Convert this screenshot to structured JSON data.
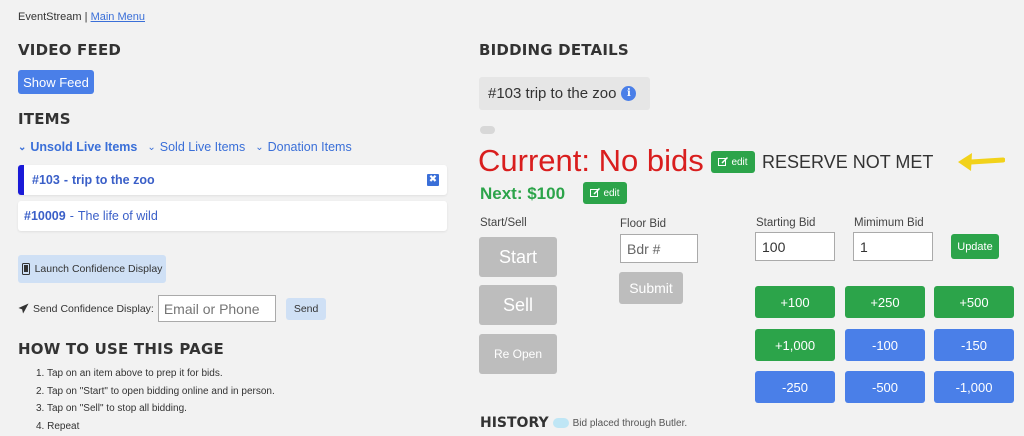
{
  "topbar": {
    "app_name": "EventStream",
    "separator": "|",
    "main_menu": "Main Menu"
  },
  "video_feed": {
    "heading": "VIDEO FEED",
    "show_feed": "Show Feed"
  },
  "items": {
    "heading": "ITEMS",
    "tabs": [
      {
        "label": "Unsold Live Items",
        "active": true
      },
      {
        "label": "Sold Live Items",
        "active": false
      },
      {
        "label": "Donation Items",
        "active": false
      }
    ],
    "list": [
      {
        "number": "#103",
        "name": "trip to the zoo",
        "selected": true
      },
      {
        "number": "#10009",
        "name": "The life of wild",
        "selected": false
      }
    ],
    "close_glyph": "✖"
  },
  "confidence": {
    "launch_label": "Launch Confidence Display",
    "send_label": "Send Confidence Display:",
    "input_placeholder": "Email or Phone",
    "send_button": "Send"
  },
  "howto": {
    "heading": "HOW TO USE THIS PAGE",
    "steps": [
      "Tap on an item above to prep it for bids.",
      "Tap on \"Start\" to open bidding online and in person.",
      "Tap on \"Sell\" to stop all bidding.",
      "Repeat"
    ]
  },
  "bidding": {
    "heading": "BIDDING DETAILS",
    "item_title": "#103 trip to the zoo",
    "info_glyph": "i",
    "current": "Current: No bids",
    "edit_label": "edit",
    "reserve": "RESERVE NOT MET",
    "next": "Next: $100",
    "start_sell_label": "Start/Sell",
    "start": "Start",
    "sell": "Sell",
    "reopen": "Re Open",
    "floor_bid_label": "Floor Bid",
    "bidder_placeholder": "Bdr #",
    "submit": "Submit",
    "starting_bid_label": "Starting Bid",
    "starting_bid_value": "100",
    "minimum_bid_label": "Mimimum Bid",
    "minimum_bid_value": "1",
    "update": "Update",
    "increments": [
      "+100",
      "+250",
      "+500",
      "+1,000",
      "-100",
      "-150",
      "-250",
      "-500",
      "-1,000"
    ]
  },
  "history": {
    "heading": "HISTORY",
    "legend": "Bid placed through Butler."
  },
  "colors": {
    "green": "#2ca44a",
    "blue": "#4a7fe8",
    "red": "#d91e1e",
    "arrow": "#f2d21a"
  }
}
